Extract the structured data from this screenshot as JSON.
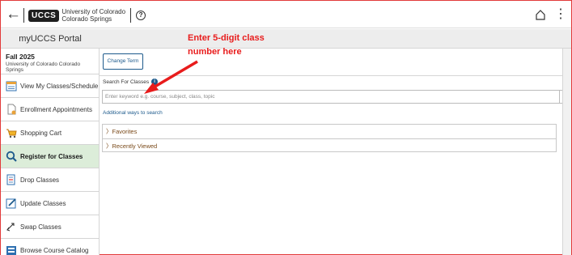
{
  "header": {
    "back": "←",
    "logo": "UCCS",
    "university_line1": "University of Colorado",
    "university_line2": "Colorado Springs",
    "help": "?",
    "menu": "⋮"
  },
  "portal": {
    "title": "myUCCS Portal"
  },
  "annotation": {
    "line1": "Enter 5-digit class",
    "line2": "number here"
  },
  "term": {
    "name": "Fall 2025",
    "school": "University of Colorado Colorado Springs"
  },
  "sidebar": {
    "items": [
      {
        "label": "View My Classes/Schedule",
        "icon": "calendar-icon"
      },
      {
        "label": "Enrollment Appointments",
        "icon": "document-icon"
      },
      {
        "label": "Shopping Cart",
        "icon": "cart-icon"
      },
      {
        "label": "Register for Classes",
        "icon": "search-icon",
        "active": true
      },
      {
        "label": "Drop Classes",
        "icon": "drop-icon"
      },
      {
        "label": "Update Classes",
        "icon": "edit-icon"
      },
      {
        "label": "Swap Classes",
        "icon": "swap-icon"
      },
      {
        "label": "Browse Course Catalog",
        "icon": "catalog-icon"
      }
    ]
  },
  "main": {
    "change_term": "Change Term",
    "search_label": "Search For Classes",
    "search_placeholder": "Enter keyword e.g. course, subject, class, topic",
    "go": "→",
    "additional_link": "Additional ways to search",
    "favorites": "〉Favorites",
    "recently_viewed": "〉Recently Viewed"
  },
  "colors": {
    "accent": "#1d5a8c",
    "active_bg": "#dcedd9",
    "annotation": "#e81c1c"
  }
}
